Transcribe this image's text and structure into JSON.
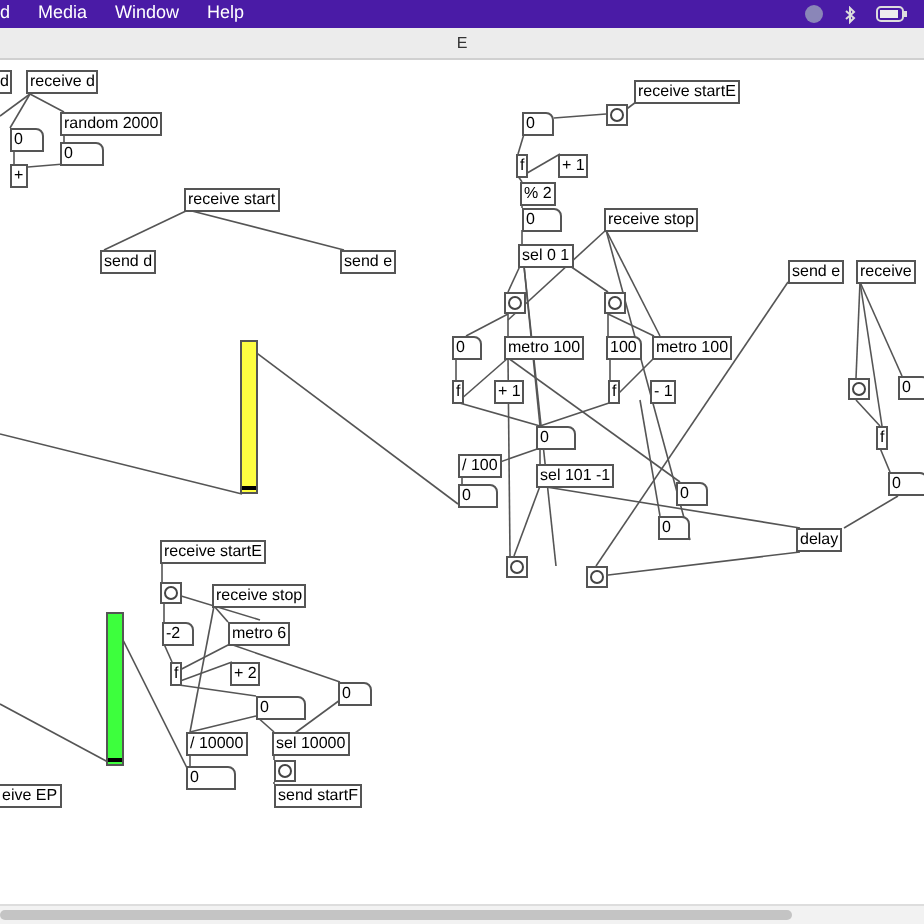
{
  "menu_bar": {
    "items": [
      "d",
      "Media",
      "Window",
      "Help"
    ]
  },
  "window": {
    "title": "E"
  },
  "canvas": {
    "boxes": [
      {
        "kind": "obj",
        "text": "d"
      },
      {
        "kind": "obj",
        "text": "receive d"
      },
      {
        "kind": "obj",
        "text": "random 2000"
      },
      {
        "kind": "number",
        "text": "0"
      },
      {
        "kind": "number",
        "text": "0"
      },
      {
        "kind": "obj",
        "text": "+"
      },
      {
        "kind": "obj",
        "text": "receive start"
      },
      {
        "kind": "obj",
        "text": "send d"
      },
      {
        "kind": "obj",
        "text": "send e"
      },
      {
        "kind": "obj",
        "text": "receive startE"
      },
      {
        "kind": "bang"
      },
      {
        "kind": "number",
        "text": "0"
      },
      {
        "kind": "obj",
        "text": "f"
      },
      {
        "kind": "obj",
        "text": "+ 1"
      },
      {
        "kind": "obj",
        "text": "% 2"
      },
      {
        "kind": "number",
        "text": "0"
      },
      {
        "kind": "obj",
        "text": "receive stop"
      },
      {
        "kind": "obj",
        "text": "sel 0 1"
      },
      {
        "kind": "obj",
        "text": "send e"
      },
      {
        "kind": "obj",
        "text": "receive"
      },
      {
        "kind": "bang"
      },
      {
        "kind": "bang"
      },
      {
        "kind": "number",
        "text": "0"
      },
      {
        "kind": "obj",
        "text": "metro 100"
      },
      {
        "kind": "number",
        "text": "100"
      },
      {
        "kind": "obj",
        "text": "metro 100"
      },
      {
        "kind": "obj",
        "text": "f"
      },
      {
        "kind": "obj",
        "text": "+ 1"
      },
      {
        "kind": "obj",
        "text": "f"
      },
      {
        "kind": "obj",
        "text": "- 1"
      },
      {
        "kind": "number",
        "text": "0"
      },
      {
        "kind": "obj",
        "text": "/ 100"
      },
      {
        "kind": "obj",
        "text": "sel 101 -1"
      },
      {
        "kind": "number",
        "text": "0"
      },
      {
        "kind": "number",
        "text": "0"
      },
      {
        "kind": "number",
        "text": "0"
      },
      {
        "kind": "obj",
        "text": "delay"
      },
      {
        "kind": "bang"
      },
      {
        "kind": "bang"
      },
      {
        "kind": "bang"
      },
      {
        "kind": "number",
        "text": "0"
      },
      {
        "kind": "obj",
        "text": "f"
      },
      {
        "kind": "number",
        "text": "0"
      },
      {
        "kind": "slider",
        "color": "#ffff41",
        "level": 0.02
      },
      {
        "kind": "obj",
        "text": "receive startE"
      },
      {
        "kind": "bang"
      },
      {
        "kind": "obj",
        "text": "receive stop"
      },
      {
        "kind": "number",
        "text": "-2"
      },
      {
        "kind": "obj",
        "text": "metro 6"
      },
      {
        "kind": "slider",
        "color": "#3dff3d",
        "level": 0.02
      },
      {
        "kind": "obj",
        "text": "f"
      },
      {
        "kind": "obj",
        "text": "+ 2"
      },
      {
        "kind": "number",
        "text": "0"
      },
      {
        "kind": "number",
        "text": "0"
      },
      {
        "kind": "obj",
        "text": "/ 10000"
      },
      {
        "kind": "obj",
        "text": "sel 10000"
      },
      {
        "kind": "number",
        "text": "0"
      },
      {
        "kind": "bang"
      },
      {
        "kind": "obj",
        "text": "send startF"
      },
      {
        "kind": "obj",
        "text": "eive EP"
      }
    ]
  }
}
